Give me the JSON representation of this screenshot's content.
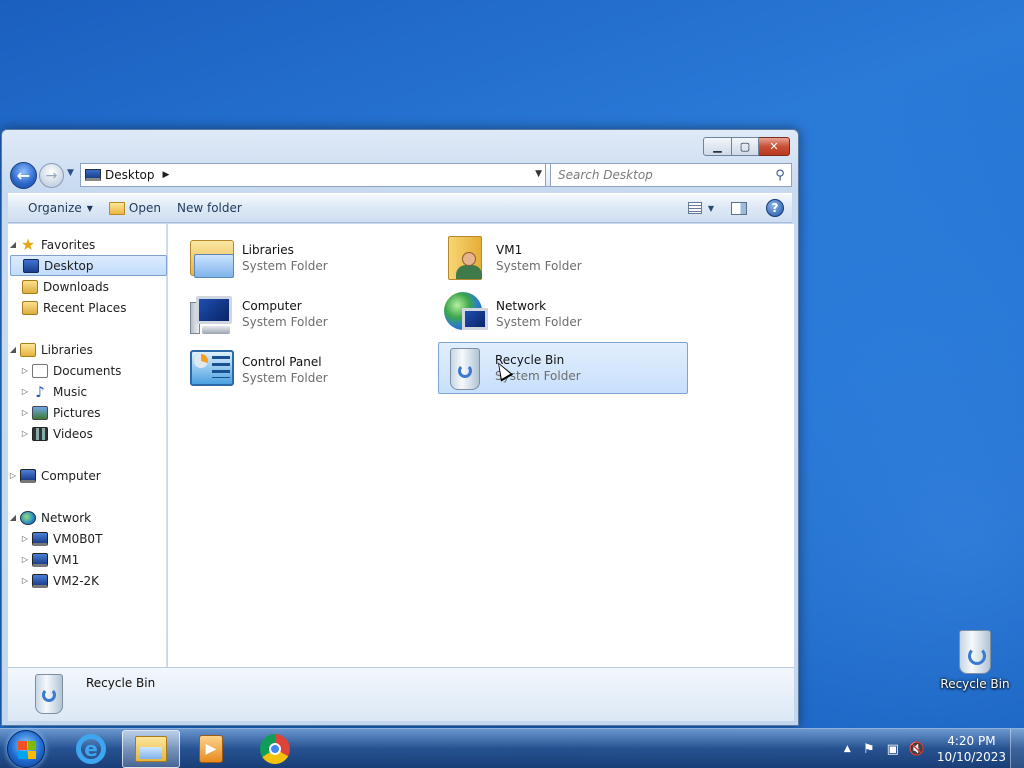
{
  "window": {
    "address": {
      "crumb": "Desktop"
    },
    "search": {
      "placeholder": "Search Desktop"
    },
    "toolbar": {
      "organize": "Organize",
      "open": "Open",
      "new_folder": "New folder"
    },
    "nav": {
      "favorites": "Favorites",
      "desktop": "Desktop",
      "downloads": "Downloads",
      "recent_places": "Recent Places",
      "libraries": "Libraries",
      "documents": "Documents",
      "music": "Music",
      "pictures": "Pictures",
      "videos": "Videos",
      "computer": "Computer",
      "network": "Network",
      "hosts": [
        "VM0B0T",
        "VM1",
        "VM2-2K"
      ]
    },
    "items": [
      {
        "name": "Libraries",
        "type": "System Folder"
      },
      {
        "name": "VM1",
        "type": "System Folder"
      },
      {
        "name": "Computer",
        "type": "System Folder"
      },
      {
        "name": "Network",
        "type": "System Folder"
      },
      {
        "name": "Control Panel",
        "type": "System Folder"
      },
      {
        "name": "Recycle Bin",
        "type": "System Folder"
      }
    ],
    "details": {
      "name": "Recycle Bin"
    }
  },
  "desktop": {
    "recycle_bin_label": "Recycle Bin"
  },
  "taskbar": {
    "time": "4:20 PM",
    "date": "10/10/2023"
  },
  "colors": {
    "accent": "#2a7ad8",
    "selection": "#c7e0fc",
    "close": "#c94f35"
  }
}
